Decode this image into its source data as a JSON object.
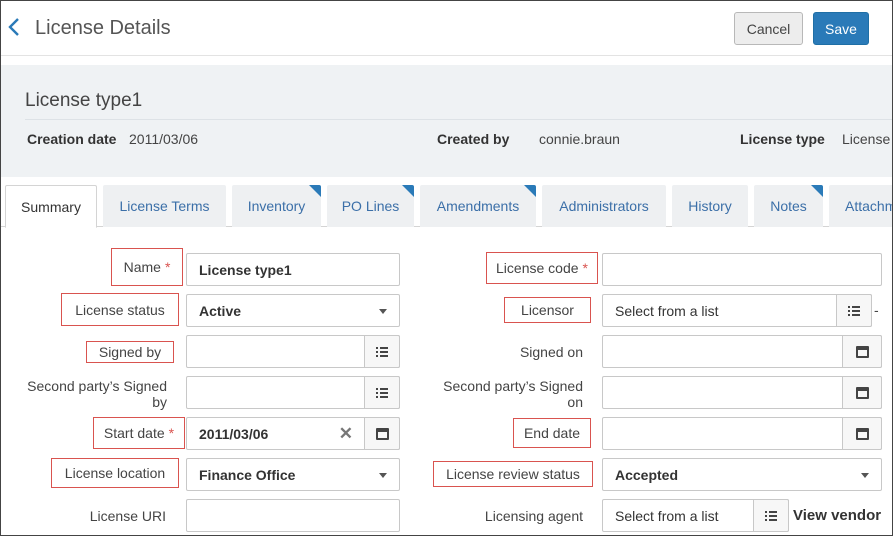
{
  "header": {
    "title": "License Details",
    "cancel_label": "Cancel",
    "save_label": "Save"
  },
  "record": {
    "title": "License type1",
    "creation_date_label": "Creation date",
    "creation_date": "2011/03/06",
    "created_by_label": "Created by",
    "created_by": "connie.braun",
    "license_type_label": "License type",
    "license_type": "License"
  },
  "tabs": [
    {
      "label": "Summary"
    },
    {
      "label": "License Terms"
    },
    {
      "label": "Inventory"
    },
    {
      "label": "PO Lines"
    },
    {
      "label": "Amendments"
    },
    {
      "label": "Administrators"
    },
    {
      "label": "History"
    },
    {
      "label": "Notes"
    },
    {
      "label": "Attachments"
    }
  ],
  "form": {
    "name": {
      "label": "Name",
      "value": "License type1"
    },
    "license_code": {
      "label": "License code",
      "value": ""
    },
    "license_status": {
      "label": "License status",
      "value": "Active"
    },
    "licensor": {
      "label": "Licensor",
      "placeholder": "Select from a list"
    },
    "signed_by": {
      "label": "Signed by",
      "value": ""
    },
    "signed_on": {
      "label": "Signed on",
      "value": ""
    },
    "second_party_signed_by": {
      "label": "Second party’s Signed by",
      "value": ""
    },
    "second_party_signed_on": {
      "label": "Second party’s Signed on",
      "value": ""
    },
    "start_date": {
      "label": "Start date",
      "value": "2011/03/06"
    },
    "end_date": {
      "label": "End date",
      "value": ""
    },
    "license_location": {
      "label": "License location",
      "value": "Finance Office"
    },
    "license_review_status": {
      "label": "License review status",
      "value": "Accepted"
    },
    "license_uri": {
      "label": "License URI",
      "value": ""
    },
    "licensing_agent": {
      "label": "Licensing agent",
      "placeholder": "Select from a list"
    },
    "required_mark": "*",
    "licensor_dash": "-",
    "view_vendor_label": "View vendor"
  },
  "colors": {
    "accent": "#2a7ab8",
    "required": "#d9534f",
    "tab_link": "#3b6fa8"
  }
}
